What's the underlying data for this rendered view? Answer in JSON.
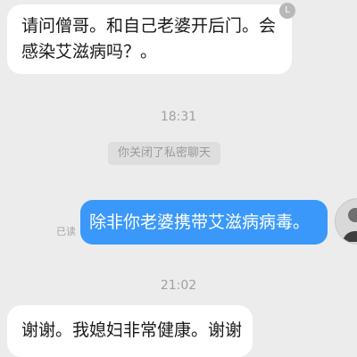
{
  "messages": {
    "incoming_1": {
      "line1": "请问僧哥。和自己老婆开后门。会",
      "line2": "感染艾滋病吗？。"
    },
    "timestamp_1": "18:31",
    "system_notice": "你关闭了私密聊天",
    "outgoing_1": {
      "text": "除非你老婆携带艾滋病病毒。",
      "read_status": "已读"
    },
    "timestamp_2": "21:02",
    "incoming_2": {
      "text": "谢谢。我媳妇非常健康。谢谢"
    }
  },
  "icons": {
    "read_receipt_icon": "L",
    "avatar": "user-avatar"
  },
  "colors": {
    "background": "#ececec",
    "incoming_bubble": "#ffffff",
    "outgoing_bubble": "#3a98fa"
  }
}
